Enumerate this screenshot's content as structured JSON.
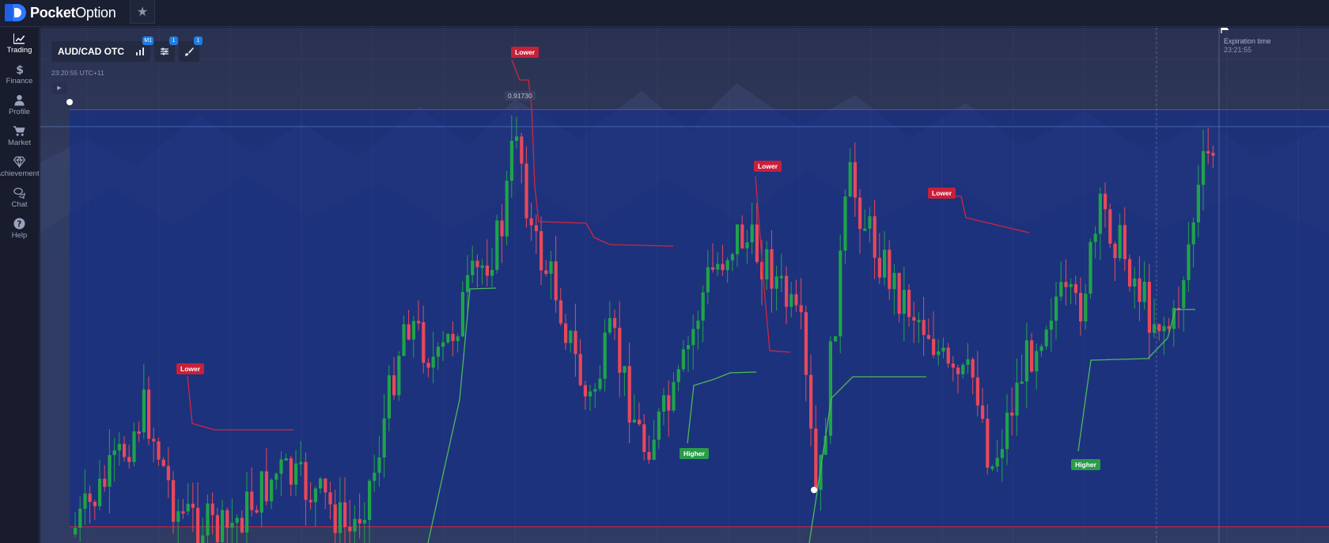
{
  "app": {
    "logo_bold": "Pocket",
    "logo_light": "Option",
    "favorite_icon": "star-icon"
  },
  "sidebar": {
    "items": [
      {
        "label": "Trading",
        "icon": "chart-line-icon",
        "active": true
      },
      {
        "label": "Finance",
        "icon": "dollar-icon",
        "active": false
      },
      {
        "label": "Profile",
        "icon": "user-icon",
        "active": false
      },
      {
        "label": "Market",
        "icon": "cart-icon",
        "active": false
      },
      {
        "label": "Achievements",
        "icon": "diamond-icon",
        "active": false
      },
      {
        "label": "Chat",
        "icon": "chat-icon",
        "active": false
      },
      {
        "label": "Help",
        "icon": "help-icon",
        "active": false
      }
    ]
  },
  "toolbar": {
    "asset": "AUD/CAD OTC",
    "timeframe_badge": "M1",
    "indicators_badge": "1",
    "drawings_badge": "1"
  },
  "chart": {
    "clock": "23:20:55 UTC+11",
    "price_tag": "0.91730",
    "expiration_label": "Expiration time",
    "expiration_time": "23:21:55",
    "deals": [
      {
        "direction": "lower",
        "label": "Lower"
      },
      {
        "direction": "lower",
        "label": "Lower"
      },
      {
        "direction": "lower",
        "label": "Lower"
      },
      {
        "direction": "lower",
        "label": "Lower"
      },
      {
        "direction": "higher",
        "label": "Higher"
      },
      {
        "direction": "higher",
        "label": "Higher"
      }
    ],
    "colors": {
      "up": "#1fa34a",
      "down": "#e8485a",
      "zone": "#1a3a9c",
      "zone_border": "#c8283f",
      "lower_label": "#c8203a",
      "higher_label": "#2a9b4a"
    }
  }
}
